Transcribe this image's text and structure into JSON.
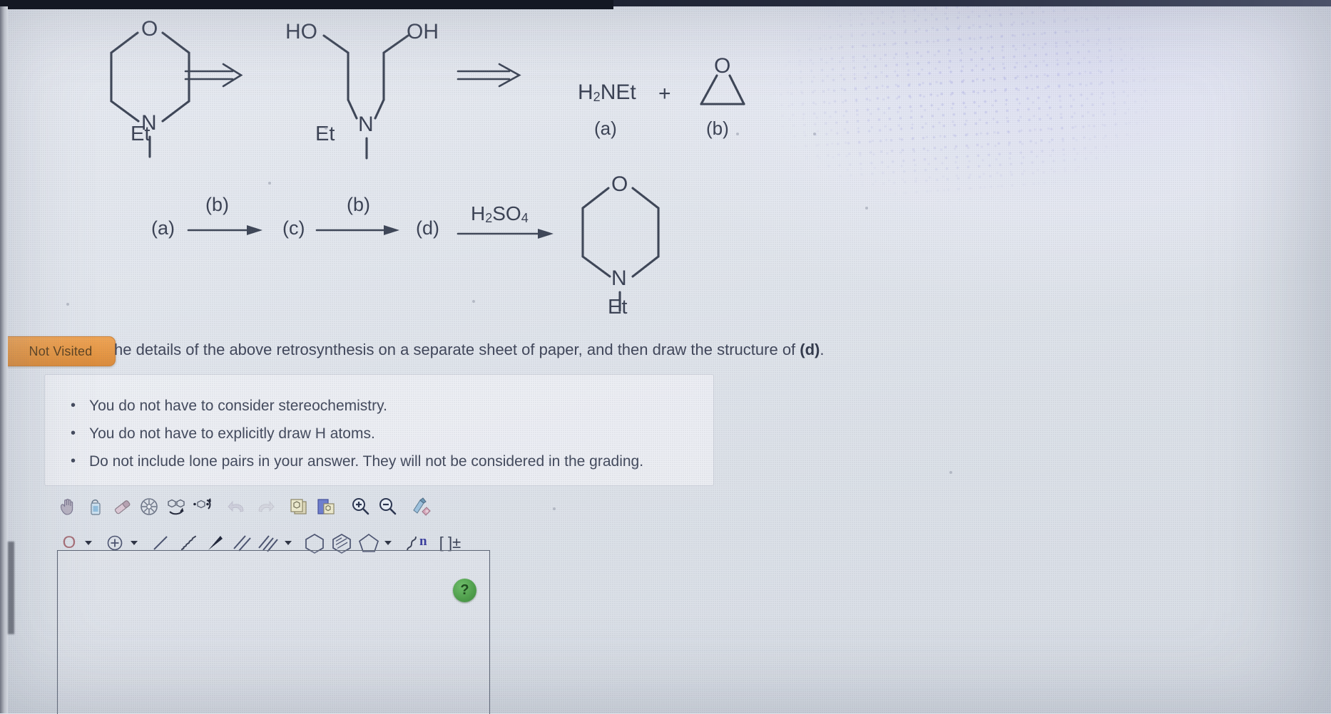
{
  "badge": {
    "label": "Not Visited"
  },
  "instruction": {
    "occluded_prefix": "he details of the above retrosynthesis on a separate sheet of paper, and then draw the structure of ",
    "bold_target": "(d)",
    "suffix": "."
  },
  "bullets": [
    "You do not have to consider stereochemistry.",
    "You do not have to explicitly draw H atoms.",
    "Do not include lone pairs in your answer. They will not be considered in the grading."
  ],
  "retrosynthesis": {
    "step1_product_label": "Et",
    "product_o": "O",
    "product_n": "N",
    "arrow1": "retro-arrow",
    "diol_ho": "HO",
    "diol_oh": "OH",
    "diol_n": "N",
    "diol_et": "Et",
    "arrow2": "retro-arrow",
    "amine_formula_1": "H",
    "amine_sub": "2",
    "amine_formula_2": "NEt",
    "amine_label": "(a)",
    "plus": "+",
    "epoxide_o": "O",
    "epoxide_label": "(b)"
  },
  "forward_scheme": {
    "start": "(a)",
    "reagent1": "(b)",
    "intermediate": "(c)",
    "reagent2": "(b)",
    "product_d": "(d)",
    "reagent3_1": "H",
    "reagent3_sub1": "2",
    "reagent3_2": "SO",
    "reagent3_sub2": "4",
    "final_o": "O",
    "final_n": "N",
    "final_et": "Et"
  },
  "toolbar_row1": [
    {
      "name": "hand-pan-icon",
      "title": "Pan"
    },
    {
      "name": "lasso-select-icon",
      "title": "Select"
    },
    {
      "name": "eraser-icon",
      "title": "Eraser"
    },
    {
      "name": "clean-structure-icon",
      "title": "Clean Structure"
    },
    {
      "name": "flip-horizontal-icon",
      "title": "Flip Horizontal"
    },
    {
      "name": "rotate-icon",
      "title": "Rotate"
    },
    {
      "name": "undo-icon",
      "title": "Undo"
    },
    {
      "name": "redo-icon",
      "title": "Redo"
    },
    {
      "name": "copy-icon",
      "title": "Copy"
    },
    {
      "name": "paste-icon",
      "title": "Paste"
    },
    {
      "name": "zoom-in-icon",
      "title": "Zoom In"
    },
    {
      "name": "zoom-out-icon",
      "title": "Zoom Out"
    },
    {
      "name": "format-brush-icon",
      "title": "Format"
    }
  ],
  "toolbar_row2": [
    {
      "name": "atom-oxygen-tool",
      "label": "O"
    },
    {
      "name": "atom-oxygen-dropdown"
    },
    {
      "name": "charge-plus-tool"
    },
    {
      "name": "charge-dropdown"
    },
    {
      "name": "single-bond-tool"
    },
    {
      "name": "hashed-wedge-bond-tool"
    },
    {
      "name": "bold-wedge-bond-tool"
    },
    {
      "name": "double-bond-tool"
    },
    {
      "name": "triple-bond-tool"
    },
    {
      "name": "bond-dropdown"
    },
    {
      "name": "cyclohexane-ring-tool"
    },
    {
      "name": "benzene-ring-tool"
    },
    {
      "name": "cyclopentane-ring-tool"
    },
    {
      "name": "ring-dropdown"
    },
    {
      "name": "polymer-repeat-tool",
      "label": "n"
    },
    {
      "name": "bracket-charge-tool",
      "label": "[ ]±"
    }
  ],
  "help_button": {
    "label": "?"
  },
  "colors": {
    "badge_bg": "#e79845",
    "badge_text": "#5d4322",
    "bond": "#3e4657",
    "text": "#40465a",
    "help_green": "#4e9f4a",
    "page_bg": "#e4e8ef"
  }
}
